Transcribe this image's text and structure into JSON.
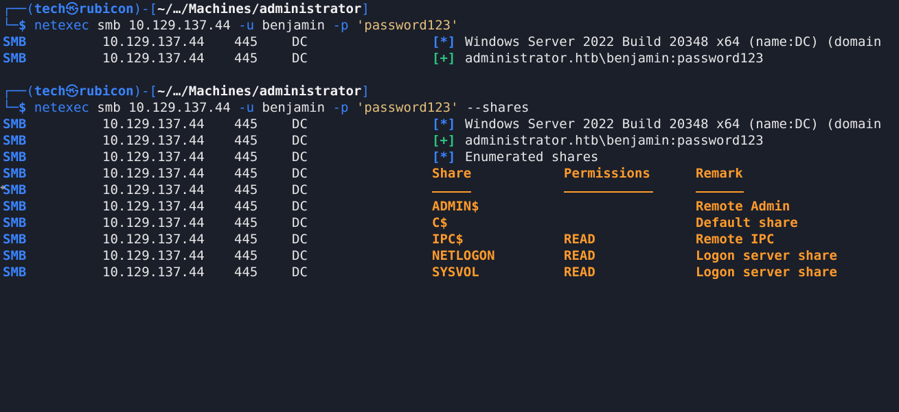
{
  "prompts": [
    {
      "frame_top": "┌──(",
      "user": "tech",
      "skull": "㉿",
      "host": "rubicon",
      "mid": ")-[",
      "path": "~/…/Machines/administrator",
      "close": "]",
      "frame_bottom": "└─",
      "dollar": "$",
      "command": "netexec",
      "args": " smb 10.129.137.44 ",
      "flag_u": "-u",
      "user_arg": " benjamin ",
      "flag_p": "-p",
      "password": " 'password123'",
      "extra": ""
    },
    {
      "frame_top": "┌──(",
      "user": "tech",
      "skull": "㉿",
      "host": "rubicon",
      "mid": ")-[",
      "path": "~/…/Machines/administrator",
      "close": "]",
      "frame_bottom": "└─",
      "dollar": "$",
      "command": "netexec",
      "args": " smb 10.129.137.44 ",
      "flag_u": "-u",
      "user_arg": " benjamin ",
      "flag_p": "-p",
      "password": " 'password123'",
      "extra": " --shares"
    }
  ],
  "row_prefix": {
    "proto": "SMB",
    "ip": "10.129.137.44",
    "port": "445",
    "host": "DC"
  },
  "block1": [
    {
      "tag": "[*]",
      "tag_type": "info",
      "text": "Windows Server 2022 Build 20348 x64 (name:DC) (domain"
    },
    {
      "tag": "[+]",
      "tag_type": "ok",
      "text": "administrator.htb\\benjamin:password123"
    }
  ],
  "block2_status": [
    {
      "tag": "[*]",
      "tag_type": "info",
      "text": "Windows Server 2022 Build 20348 x64 (name:DC) (domain"
    },
    {
      "tag": "[+]",
      "tag_type": "ok",
      "text": "administrator.htb\\benjamin:password123"
    },
    {
      "tag": "[*]",
      "tag_type": "info",
      "text": "Enumerated shares"
    }
  ],
  "shares_table": {
    "headers": {
      "share": "Share",
      "permissions": "Permissions",
      "remark": "Remark"
    },
    "rows": [
      {
        "share": "ADMIN$",
        "permissions": "",
        "remark": "Remote Admin"
      },
      {
        "share": "C$",
        "permissions": "",
        "remark": "Default share"
      },
      {
        "share": "IPC$",
        "permissions": "READ",
        "remark": "Remote IPC"
      },
      {
        "share": "NETLOGON",
        "permissions": "READ",
        "remark": "Logon server share"
      },
      {
        "share": "SYSVOL",
        "permissions": "READ",
        "remark": "Logon server share"
      }
    ]
  },
  "cursor_glyph": "⌖",
  "colors": {
    "background": "#1b1f2a",
    "blue": "#3a84ff",
    "green": "#2ec27e",
    "orange": "#ff9b2b",
    "yellow": "#e5c07b",
    "text": "#e6e6e6"
  }
}
